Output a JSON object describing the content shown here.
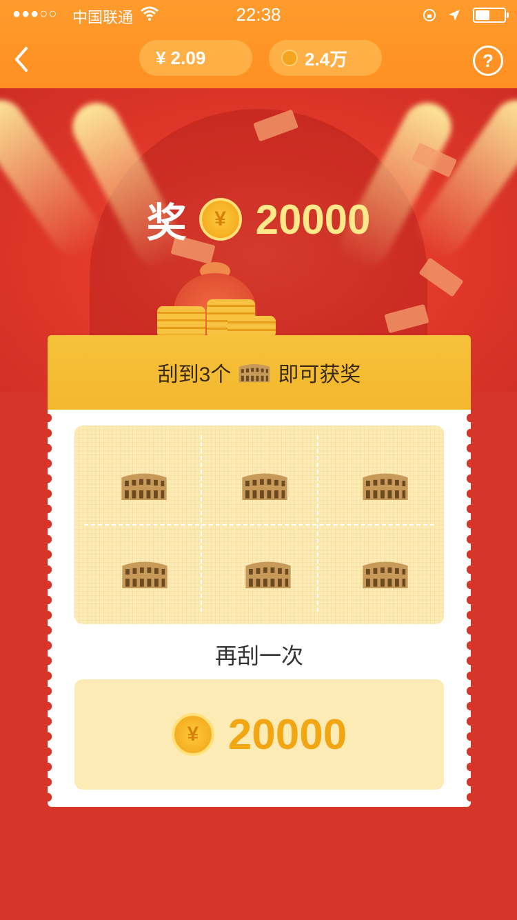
{
  "status_bar": {
    "signal": "●●●○○",
    "carrier": "中国联通",
    "time": "22:38",
    "battery_level": 0.5
  },
  "nav": {
    "back_icon": "chevron-left-icon",
    "cash_balance": "¥ 2.09",
    "coin_balance": "2.4万",
    "help_icon": "?"
  },
  "hero": {
    "prize_label": "奖",
    "prize_coin_symbol": "¥",
    "prize_amount": "20000"
  },
  "ticket": {
    "instruction_prefix": "刮到3个",
    "instruction_suffix": "即可获奖",
    "symbol_icon": "colosseum-icon",
    "again_label": "再刮一次",
    "reward_coin_symbol": "¥",
    "reward_amount": "20000"
  },
  "colors": {
    "nav_orange": "#ff9b2c",
    "page_red": "#d7342a",
    "gold_text": "#f2a614",
    "ticket_header": "#f6c23a",
    "scratch_area": "#fdebb6"
  }
}
